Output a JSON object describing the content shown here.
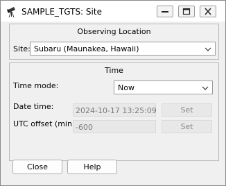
{
  "window": {
    "title": "SAMPLE_TGTS: Site",
    "app_icon": "telescope-icon"
  },
  "observing_location": {
    "group_title": "Observing Location",
    "site_label": "Site:",
    "site_value": "Subaru (Maunakea, Hawaii)"
  },
  "time": {
    "group_title": "Time",
    "mode_label": "Time mode:",
    "mode_value": "Now",
    "date_label": "Date time:",
    "date_value": "2024-10-17 13:25:09",
    "date_set_label": "Set",
    "utc_label": "UTC offset (min):",
    "utc_value": "-600",
    "utc_set_label": "Set"
  },
  "buttons": {
    "close_label": "Close",
    "help_label": "Help"
  }
}
